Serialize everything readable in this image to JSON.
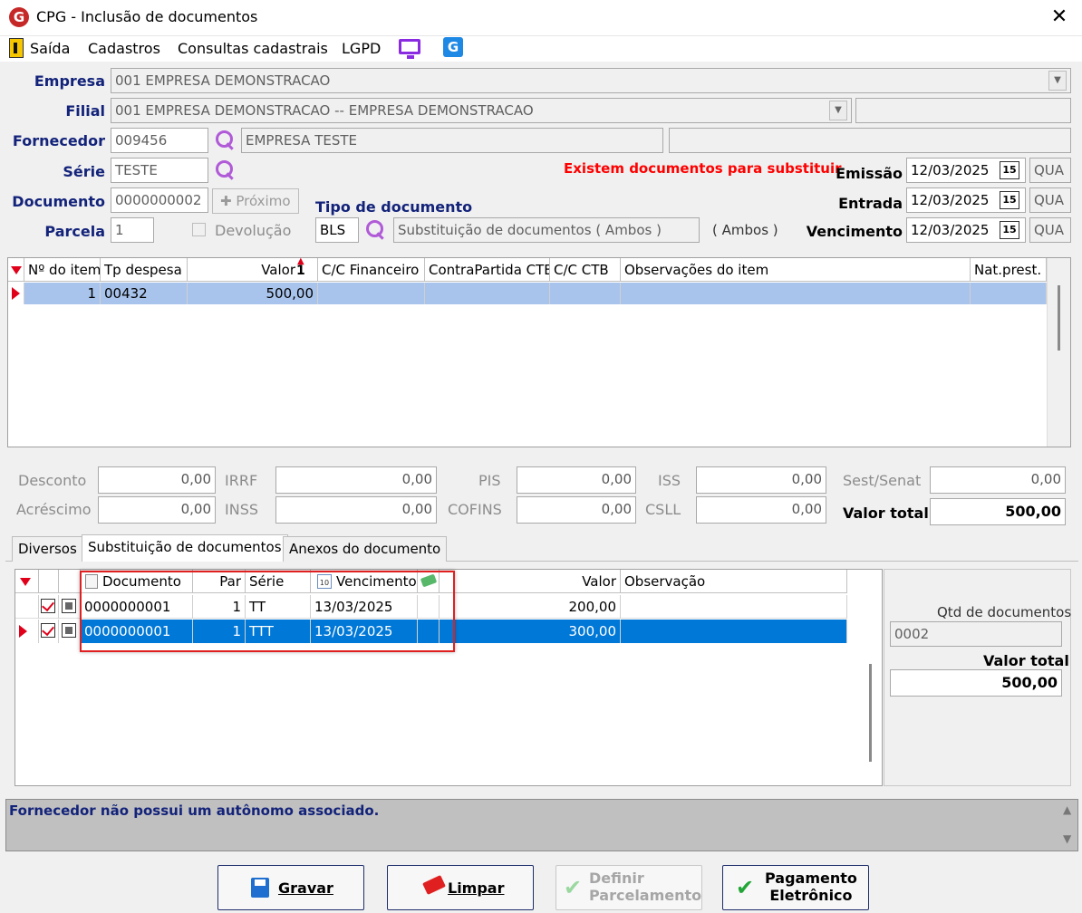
{
  "window": {
    "title": "CPG - Inclusão de documentos",
    "logo_letter": "G",
    "close": "✕"
  },
  "menu": {
    "items": [
      "Saída",
      "Cadastros",
      "Consultas cadastrais",
      "LGPD"
    ]
  },
  "form": {
    "empresa_label": "Empresa",
    "empresa_value": "001 EMPRESA DEMONSTRACAO",
    "filial_label": "Filial",
    "filial_value": "001 EMPRESA DEMONSTRACAO -- EMPRESA DEMONSTRACAO",
    "fornecedor_label": "Fornecedor",
    "fornecedor_code": "009456",
    "fornecedor_name": "EMPRESA TESTE",
    "serie_label": "Série",
    "serie_value": "TESTE",
    "documento_label": "Documento",
    "documento_value": "0000000002",
    "proximo_label": "Próximo",
    "parcela_label": "Parcela",
    "parcela_value": "1",
    "devolucao_label": "Devolução",
    "tipo_doc_label": "Tipo de documento",
    "tipo_doc_code": "BLS",
    "tipo_doc_desc": "Substituição de documentos ( Ambos )",
    "tipo_doc_extra": "( Ambos )",
    "warning": "Existem documentos para substituir",
    "emissao_label": "Emissão",
    "emissao_value": "12/03/2025",
    "emissao_day": "QUA",
    "entrada_label": "Entrada",
    "entrada_value": "12/03/2025",
    "entrada_day": "QUA",
    "vencimento_label": "Vencimento",
    "vencimento_value": "12/03/2025",
    "vencimento_day": "QUA",
    "cal_glyph": "15"
  },
  "items_grid": {
    "headers": [
      "Nº do item",
      "Tp despesa",
      "Valor",
      "C/C Financeiro",
      "ContraPartida CTB",
      "C/C CTB",
      "Observações do item",
      "Nat.prest."
    ],
    "sort_indicator": "1",
    "rows": [
      {
        "item": "1",
        "tp": "00432",
        "valor": "500,00"
      }
    ]
  },
  "totals": {
    "desconto_label": "Desconto",
    "desconto": "0,00",
    "irrf_label": "IRRF",
    "irrf": "0,00",
    "pis_label": "PIS",
    "pis": "0,00",
    "iss_label": "ISS",
    "iss": "0,00",
    "sest_label": "Sest/Senat",
    "sest": "0,00",
    "acrescimo_label": "Acréscimo",
    "acrescimo": "0,00",
    "inss_label": "INSS",
    "inss": "0,00",
    "cofins_label": "COFINS",
    "cofins": "0,00",
    "csll_label": "CSLL",
    "csll": "0,00",
    "valor_total_label": "Valor total",
    "valor_total": "500,00"
  },
  "tabs": [
    "Diversos",
    "Substituição de documentos",
    "Anexos do documento"
  ],
  "subst_grid": {
    "headers": [
      "Documento",
      "Par",
      "Série",
      "Vencimento",
      "Valor",
      "Observação"
    ],
    "rows": [
      {
        "doc": "0000000001",
        "par": "1",
        "serie": "TT",
        "venc": "13/03/2025",
        "valor": "200,00"
      },
      {
        "doc": "0000000001",
        "par": "1",
        "serie": "TTT",
        "venc": "13/03/2025",
        "valor": "300,00"
      }
    ]
  },
  "side_panel": {
    "qtd_label": "Qtd de documentos",
    "qtd_value": "0002",
    "valor_label": "Valor total",
    "valor_value": "500,00"
  },
  "status": {
    "message": "Fornecedor não possui um autônomo associado."
  },
  "buttons": {
    "gravar": "Gravar",
    "limpar": "Limpar",
    "definir_1": "Definir",
    "definir_2": "Parcelamento",
    "pagamento_1": "Pagamento",
    "pagamento_2": "Eletrônico"
  },
  "colors": {
    "label": "#13237a",
    "warning": "#ff0000",
    "row_selected": "#0078d7",
    "row_highlight": "#a9c4ec"
  }
}
